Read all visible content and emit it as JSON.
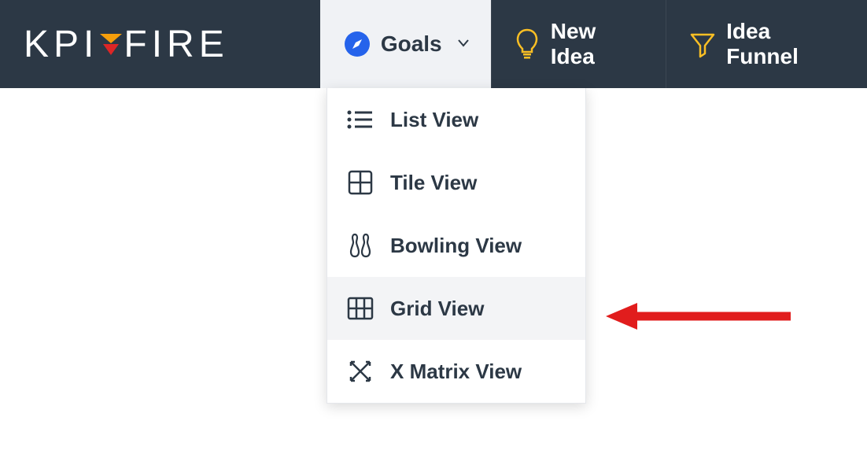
{
  "logo": {
    "text_before": "KPI",
    "text_after": "FIRE"
  },
  "nav": {
    "goals": {
      "label": "Goals"
    },
    "new_idea": {
      "label": "New Idea"
    },
    "idea_funnel": {
      "label": "Idea Funnel"
    }
  },
  "dropdown": {
    "items": [
      {
        "label": "List View",
        "icon": "list-icon",
        "highlighted": false
      },
      {
        "label": "Tile View",
        "icon": "tile-icon",
        "highlighted": false
      },
      {
        "label": "Bowling View",
        "icon": "bowling-icon",
        "highlighted": false
      },
      {
        "label": "Grid View",
        "icon": "grid-icon",
        "highlighted": true
      },
      {
        "label": "X Matrix View",
        "icon": "xmatrix-icon",
        "highlighted": false
      }
    ]
  }
}
